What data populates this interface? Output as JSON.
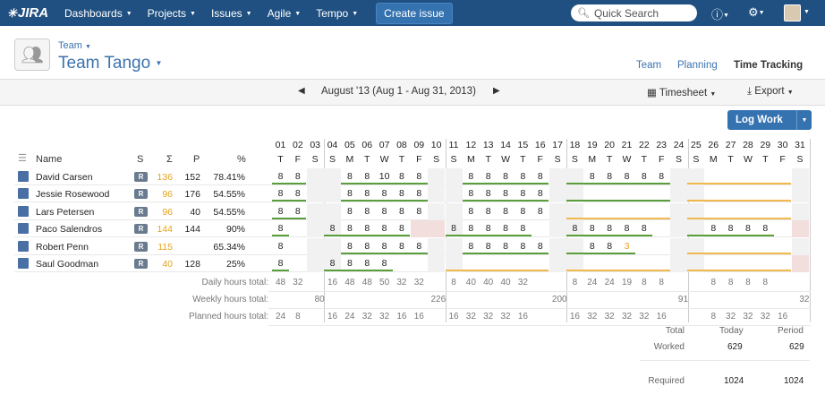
{
  "topnav": {
    "logo": "JIRA",
    "items": [
      "Dashboards",
      "Projects",
      "Issues",
      "Agile",
      "Tempo"
    ],
    "create": "Create issue",
    "search_placeholder": "Quick Search"
  },
  "project": {
    "type": "Team",
    "name": "Team Tango"
  },
  "tabs": [
    "Team",
    "Planning",
    "Time Tracking"
  ],
  "period": "August '13 (Aug 1 - Aug 31, 2013)",
  "timesheet_btn": "Timesheet",
  "export_btn": "Export",
  "log_work": "Log Work",
  "columns": {
    "name": "Name",
    "s": "S",
    "sigma": "Σ",
    "p": "P",
    "pct": "%"
  },
  "days": [
    {
      "d": "01",
      "w": "T"
    },
    {
      "d": "02",
      "w": "F"
    },
    {
      "d": "03",
      "w": "S"
    },
    {
      "d": "04",
      "w": "S"
    },
    {
      "d": "05",
      "w": "M"
    },
    {
      "d": "06",
      "w": "T"
    },
    {
      "d": "07",
      "w": "W"
    },
    {
      "d": "08",
      "w": "T"
    },
    {
      "d": "09",
      "w": "F"
    },
    {
      "d": "10",
      "w": "S"
    },
    {
      "d": "11",
      "w": "S"
    },
    {
      "d": "12",
      "w": "M"
    },
    {
      "d": "13",
      "w": "T"
    },
    {
      "d": "14",
      "w": "W"
    },
    {
      "d": "15",
      "w": "T"
    },
    {
      "d": "16",
      "w": "F"
    },
    {
      "d": "17",
      "w": "S"
    },
    {
      "d": "18",
      "w": "S"
    },
    {
      "d": "19",
      "w": "M"
    },
    {
      "d": "20",
      "w": "T"
    },
    {
      "d": "21",
      "w": "W"
    },
    {
      "d": "22",
      "w": "T"
    },
    {
      "d": "23",
      "w": "F"
    },
    {
      "d": "24",
      "w": "S"
    },
    {
      "d": "25",
      "w": "S"
    },
    {
      "d": "26",
      "w": "M"
    },
    {
      "d": "27",
      "w": "T"
    },
    {
      "d": "28",
      "w": "W"
    },
    {
      "d": "29",
      "w": "T"
    },
    {
      "d": "30",
      "w": "F"
    },
    {
      "d": "31",
      "w": "S"
    }
  ],
  "users": [
    {
      "name": "David Carsen",
      "s": "R",
      "sigma": "136",
      "p": "152",
      "pct": "78.41%",
      "hours": {
        "1": "8",
        "2": "8",
        "5": "8",
        "6": "8",
        "7": "10",
        "8": "8",
        "9": "8",
        "12": "8",
        "13": "8",
        "14": "8",
        "15": "8",
        "16": "8",
        "19": "8",
        "20": "8",
        "21": "8",
        "22": "8",
        "23": "8"
      }
    },
    {
      "name": "Jessie Rosewood",
      "s": "R",
      "sigma": "96",
      "p": "176",
      "pct": "54.55%",
      "hours": {
        "1": "8",
        "2": "8",
        "5": "8",
        "6": "8",
        "7": "8",
        "8": "8",
        "9": "8",
        "12": "8",
        "13": "8",
        "14": "8",
        "15": "8",
        "16": "8"
      }
    },
    {
      "name": "Lars Petersen",
      "s": "R",
      "sigma": "96",
      "p": "40",
      "pct": "54.55%",
      "hours": {
        "1": "8",
        "2": "8",
        "5": "8",
        "6": "8",
        "7": "8",
        "8": "8",
        "9": "8",
        "12": "8",
        "13": "8",
        "14": "8",
        "15": "8",
        "16": "8"
      }
    },
    {
      "name": "Paco Salendros",
      "s": "R",
      "sigma": "144",
      "p": "144",
      "pct": "90%",
      "hours": {
        "1": "8",
        "4": "8",
        "5": "8",
        "6": "8",
        "7": "8",
        "8": "8",
        "11": "8",
        "12": "8",
        "13": "8",
        "14": "8",
        "15": "8",
        "18": "8",
        "19": "8",
        "20": "8",
        "21": "8",
        "22": "8",
        "26": "8",
        "27": "8",
        "28": "8",
        "29": "8"
      }
    },
    {
      "name": "Robert Penn",
      "s": "R",
      "sigma": "115",
      "p": "",
      "pct": "65.34%",
      "hours": {
        "1": "8",
        "5": "8",
        "6": "8",
        "7": "8",
        "8": "8",
        "9": "8",
        "12": "8",
        "13": "8",
        "14": "8",
        "15": "8",
        "16": "8",
        "19": "8",
        "20": "8",
        "21": "3"
      }
    },
    {
      "name": "Saul Goodman",
      "s": "R",
      "sigma": "40",
      "p": "128",
      "pct": "25%",
      "hours": {
        "1": "8",
        "4": "8",
        "5": "8",
        "6": "8",
        "7": "8"
      }
    }
  ],
  "totals": {
    "daily_label": "Daily hours total:",
    "daily": {
      "1": "48",
      "2": "32",
      "4": "16",
      "5": "48",
      "6": "48",
      "7": "50",
      "8": "32",
      "9": "32",
      "11": "8",
      "12": "40",
      "13": "40",
      "14": "40",
      "15": "32",
      "18": "8",
      "19": "24",
      "20": "24",
      "21": "19",
      "22": "8",
      "23": "8",
      "26": "8",
      "27": "8",
      "28": "8",
      "29": "8"
    },
    "weekly_label": "Weekly hours total:",
    "weekly": {
      "3": "80",
      "10": "226",
      "17": "200",
      "24": "91",
      "31": "32"
    },
    "planned_label": "Planned hours total:",
    "planned": {
      "1": "24",
      "2": "8",
      "4": "16",
      "5": "24",
      "6": "32",
      "7": "32",
      "8": "16",
      "9": "16",
      "11": "16",
      "12": "32",
      "13": "32",
      "14": "32",
      "15": "16",
      "18": "16",
      "19": "32",
      "20": "32",
      "21": "32",
      "22": "32",
      "23": "16",
      "26": "8",
      "27": "32",
      "28": "32",
      "29": "32",
      "30": "16"
    }
  },
  "summary": {
    "headers": [
      "Total",
      "Today",
      "Period"
    ],
    "worked_label": "Worked",
    "worked_today": "629",
    "worked_period": "629",
    "required_label": "Required",
    "required_today": "1024",
    "required_period": "1024"
  }
}
